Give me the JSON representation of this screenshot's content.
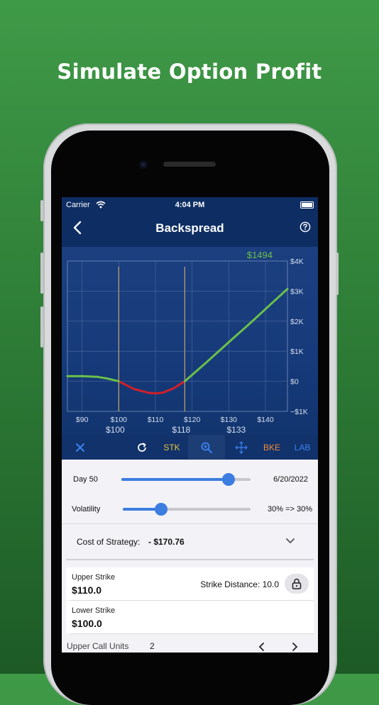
{
  "headline": "Simulate Option Profit",
  "status_bar": {
    "carrier": "Carrier",
    "time": "4:04 PM"
  },
  "nav": {
    "title": "Backspread"
  },
  "chart_data": {
    "type": "line",
    "title": "",
    "xlabel": "",
    "ylabel": "",
    "value_label": "$1494",
    "x_ticks": [
      "$90",
      "$100",
      "$110",
      "$120",
      "$130",
      "$140"
    ],
    "y_ticks": [
      "$4K",
      "$3K",
      "$2K",
      "$1K",
      "$0",
      "−$1K"
    ],
    "xlim": [
      86,
      146
    ],
    "ylim": [
      -1000,
      4000
    ],
    "strike_markers": [
      {
        "x": 100,
        "label": "$100"
      },
      {
        "x": 118,
        "label": "$118"
      },
      {
        "x": 133,
        "label": "$133"
      }
    ],
    "vertical_lines": [
      100,
      118
    ],
    "grid": true,
    "series": [
      {
        "segment": "loss",
        "color": "#d0202a",
        "x": [
          100,
          104,
          108,
          110,
          112,
          115,
          118
        ],
        "y": [
          0,
          -250,
          -380,
          -400,
          -380,
          -230,
          0
        ]
      },
      {
        "segment": "profit",
        "color": "#6cc04a",
        "x": [
          86,
          90,
          94,
          97,
          100
        ],
        "y": [
          170,
          170,
          150,
          90,
          0
        ]
      },
      {
        "segment": "profit",
        "color": "#6cc04a",
        "x": [
          118,
          124,
          130,
          136,
          140,
          146
        ],
        "y": [
          0,
          640,
          1300,
          1950,
          2400,
          3070
        ]
      }
    ]
  },
  "toolbar": {
    "stk_label": "STK",
    "bke_label": "BKE",
    "lab_label": "LAB",
    "colors": {
      "yellow": "#e8c33b",
      "orange": "#f08a3b",
      "blue": "#3b82f0"
    }
  },
  "day_slider": {
    "label": "Day 50",
    "date": "6/20/2022",
    "value_fraction": 0.83
  },
  "volatility_slider": {
    "label": "Volatility",
    "value_text": "30% => 30%",
    "value_fraction": 0.3
  },
  "cost": {
    "label": "Cost of Strategy:",
    "value": "- $170.76"
  },
  "upper_strike": {
    "label": "Upper Strike",
    "value": "$110.0",
    "distance_label": "Strike Distance: 10.0"
  },
  "lower_strike": {
    "label": "Lower Strike",
    "value": "$100.0"
  },
  "upper_call_units": {
    "label": "Upper Call Units",
    "value": "2"
  }
}
